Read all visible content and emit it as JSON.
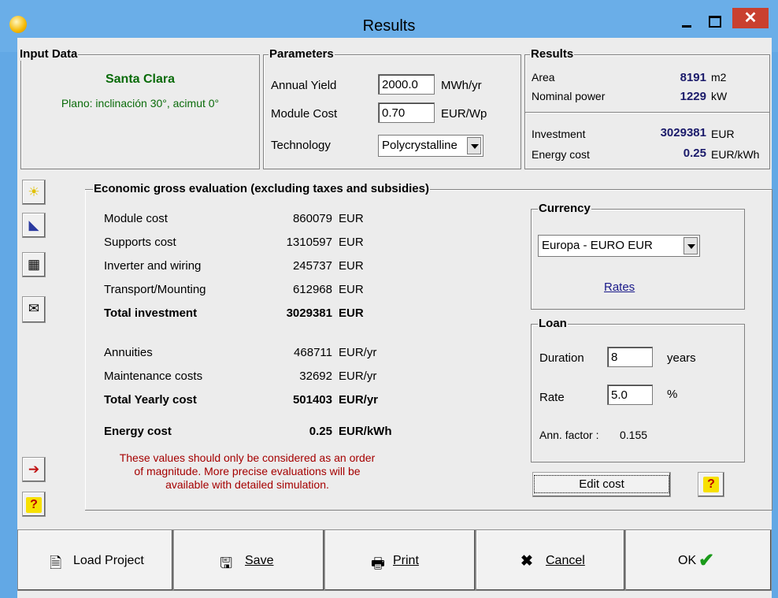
{
  "window": {
    "title": "Results"
  },
  "input_data": {
    "legend": "Input Data",
    "site": "Santa Clara",
    "orientation": "Plano: inclinación 30°, acimut 0°"
  },
  "parameters": {
    "legend": "Parameters",
    "annual_yield_label": "Annual Yield",
    "annual_yield_value": "2000.0",
    "annual_yield_unit": "MWh/yr",
    "module_cost_label": "Module Cost",
    "module_cost_value": "0.70",
    "module_cost_unit": "EUR/Wp",
    "technology_label": "Technology",
    "technology_value": "Polycrystalline"
  },
  "results": {
    "legend": "Results",
    "area_label": "Area",
    "area_value": "8191",
    "area_unit": "m2",
    "power_label": "Nominal power",
    "power_value": "1229",
    "power_unit": "kW",
    "investment_label": "Investment",
    "investment_value": "3029381",
    "investment_unit": "EUR",
    "energy_label": "Energy cost",
    "energy_value": "0.25",
    "energy_unit": "EUR/kWh"
  },
  "economic": {
    "legend": "Economic gross evaluation   (excluding taxes and subsidies)",
    "rows1": [
      {
        "label": "Module cost",
        "value": "860079",
        "unit": "EUR"
      },
      {
        "label": "Supports cost",
        "value": "1310597",
        "unit": "EUR"
      },
      {
        "label": "Inverter and wiring",
        "value": "245737",
        "unit": "EUR"
      },
      {
        "label": "Transport/Mounting",
        "value": "612968",
        "unit": "EUR"
      }
    ],
    "total_investment": {
      "label": "Total investment",
      "value": "3029381",
      "unit": "EUR"
    },
    "rows2": [
      {
        "label": "Annuities",
        "value": "468711",
        "unit": "EUR/yr"
      },
      {
        "label": "Maintenance costs",
        "value": "32692",
        "unit": "EUR/yr"
      }
    ],
    "total_yearly": {
      "label": "Total Yearly cost",
      "value": "501403",
      "unit": "EUR/yr"
    },
    "energy_cost": {
      "label": "Energy cost",
      "value": "0.25",
      "unit": "EUR/kWh"
    },
    "warning_line1": "These values should only be considered as an order",
    "warning_line2": "of magnitude. More precise evaluations will be",
    "warning_line3": "available with detailed simulation."
  },
  "currency": {
    "legend": "Currency",
    "selected": "Europa - EURO   EUR",
    "rates_link": "Rates"
  },
  "loan": {
    "legend": "Loan",
    "duration_label": "Duration",
    "duration_value": "8",
    "duration_unit": "years",
    "rate_label": "Rate",
    "rate_value": "5.0",
    "rate_unit": "%",
    "factor_label": "Ann. factor :",
    "factor_value": "0.155"
  },
  "edit_cost_label": "Edit cost",
  "help_glyph": "?",
  "bottom": {
    "load": "Load Project",
    "save": "Save",
    "print": "Print",
    "cancel": "Cancel",
    "ok": "OK"
  },
  "colors": {
    "titlebar": "#6aaee8",
    "close": "#c9402f",
    "accent_green": "#0a6b0a",
    "warning_red": "#a50000"
  }
}
